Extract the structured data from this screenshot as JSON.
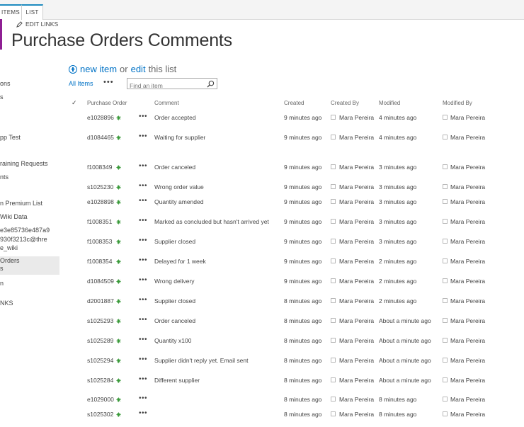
{
  "ribbon": {
    "tabs": [
      {
        "label": "ITEMS"
      },
      {
        "label": "LIST"
      }
    ]
  },
  "edit_links_label": "EDIT LINKS",
  "page_title": "Purchase Orders Comments",
  "sidebar": {
    "items": [
      {
        "label": "ons"
      },
      {
        "label": "s"
      },
      {
        "label": "pp Test"
      },
      {
        "label": "raining Requests"
      },
      {
        "label": "nts"
      },
      {
        "label": "n Premium List"
      },
      {
        "label": "Wiki Data"
      },
      {
        "label": "e3e85736e487a9"
      },
      {
        "label": "930f3213c@thre"
      },
      {
        "label": "e_wiki"
      },
      {
        "label": "Orders"
      },
      {
        "label": "s"
      },
      {
        "label": "n"
      },
      {
        "label": "NKS"
      }
    ]
  },
  "list_actions": {
    "new_item": "new item",
    "or": "or",
    "edit": "edit",
    "this_list": "this list"
  },
  "views": {
    "current": "All Items",
    "more": "•••"
  },
  "search": {
    "placeholder": "Find an item"
  },
  "columns": {
    "check": "✓",
    "purchase_order": "Purchase Order",
    "comment": "Comment",
    "created": "Created",
    "created_by": "Created By",
    "modified": "Modified",
    "modified_by": "Modified By"
  },
  "rows": [
    {
      "po": "e1028896",
      "comment": "Order accepted",
      "created": "9 minutes ago",
      "created_by": "Mara Pereira",
      "modified": "4 minutes ago",
      "modified_by": "Mara Pereira"
    },
    {
      "po": "d1084465",
      "comment": "Waiting for supplier",
      "created": "9 minutes ago",
      "created_by": "Mara Pereira",
      "modified": "4 minutes ago",
      "modified_by": "Mara Pereira"
    },
    {
      "po": "f1008349",
      "comment": "Order canceled",
      "created": "9 minutes ago",
      "created_by": "Mara Pereira",
      "modified": "3 minutes ago",
      "modified_by": "Mara Pereira"
    },
    {
      "po": "s1025230",
      "comment": "Wrong order value",
      "created": "9 minutes ago",
      "created_by": "Mara Pereira",
      "modified": "3 minutes ago",
      "modified_by": "Mara Pereira"
    },
    {
      "po": "e1028898",
      "comment": "Quantity amended",
      "created": "9 minutes ago",
      "created_by": "Mara Pereira",
      "modified": "3 minutes ago",
      "modified_by": "Mara Pereira"
    },
    {
      "po": "f1008351",
      "comment": "Marked as concluded but hasn't arrived yet",
      "created": "9 minutes ago",
      "created_by": "Mara Pereira",
      "modified": "3 minutes ago",
      "modified_by": "Mara Pereira"
    },
    {
      "po": "f1008353",
      "comment": "Supplier closed",
      "created": "9 minutes ago",
      "created_by": "Mara Pereira",
      "modified": "3 minutes ago",
      "modified_by": "Mara Pereira"
    },
    {
      "po": "f1008354",
      "comment": "Delayed for 1 week",
      "created": "9 minutes ago",
      "created_by": "Mara Pereira",
      "modified": "2 minutes ago",
      "modified_by": "Mara Pereira"
    },
    {
      "po": "d1084509",
      "comment": "Wrong delivery",
      "created": "9 minutes ago",
      "created_by": "Mara Pereira",
      "modified": "2 minutes ago",
      "modified_by": "Mara Pereira"
    },
    {
      "po": "d2001887",
      "comment": "Supplier closed",
      "created": "8 minutes ago",
      "created_by": "Mara Pereira",
      "modified": "2 minutes ago",
      "modified_by": "Mara Pereira"
    },
    {
      "po": "s1025293",
      "comment": "Order canceled",
      "created": "8 minutes ago",
      "created_by": "Mara Pereira",
      "modified": "About a minute ago",
      "modified_by": "Mara Pereira"
    },
    {
      "po": "s1025289",
      "comment": "Quantity x100",
      "created": "8 minutes ago",
      "created_by": "Mara Pereira",
      "modified": "About a minute ago",
      "modified_by": "Mara Pereira"
    },
    {
      "po": "s1025294",
      "comment": "Supplier didn't reply yet. Email sent",
      "created": "8 minutes ago",
      "created_by": "Mara Pereira",
      "modified": "About a minute ago",
      "modified_by": "Mara Pereira"
    },
    {
      "po": "s1025284",
      "comment": "Different supplier",
      "created": "8 minutes ago",
      "created_by": "Mara Pereira",
      "modified": "About a minute ago",
      "modified_by": "Mara Pereira"
    },
    {
      "po": "e1029000",
      "comment": "",
      "created": "8 minutes ago",
      "created_by": "Mara Pereira",
      "modified": "8 minutes ago",
      "modified_by": "Mara Pereira"
    },
    {
      "po": "s1025302",
      "comment": "",
      "created": "8 minutes ago",
      "created_by": "Mara Pereira",
      "modified": "8 minutes ago",
      "modified_by": "Mara Pereira"
    }
  ],
  "colors": {
    "accent": "#0072c6",
    "site_bar": "#8e1f93",
    "new_badge": "#3a9a3a"
  }
}
